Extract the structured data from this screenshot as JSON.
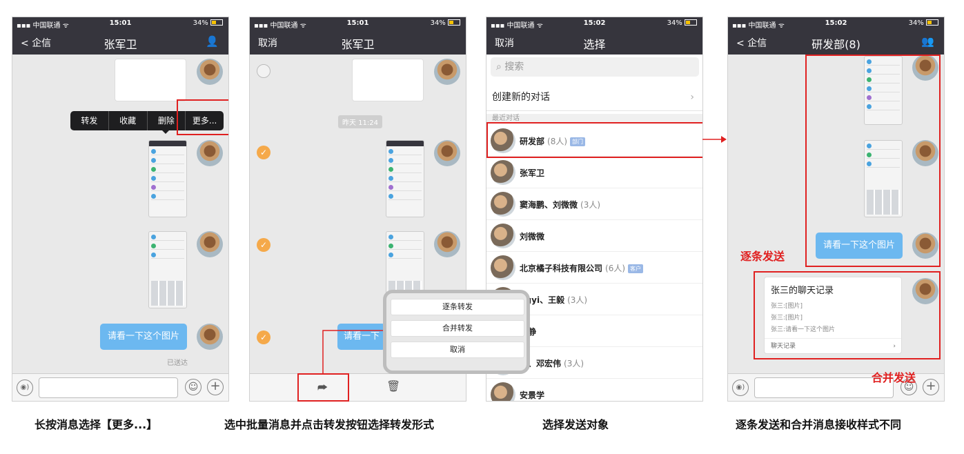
{
  "status": {
    "carrier": "中国联通",
    "battery": "34%"
  },
  "screen1": {
    "time": "15:01",
    "back": "企信",
    "title": "张军卫",
    "menu": [
      "转发",
      "收藏",
      "删除",
      "更多..."
    ],
    "message": "请看一下这个图片",
    "sent": "已送达"
  },
  "screen2": {
    "time": "15:01",
    "left": "取消",
    "title": "张军卫",
    "timestamp": "昨天 11:24",
    "message": "请看一下",
    "options": [
      "逐条转发",
      "合并转发",
      "取消"
    ]
  },
  "screen3": {
    "time": "15:02",
    "left": "取消",
    "title": "选择",
    "search_placeholder": "搜索",
    "new_chat": "创建新的对话",
    "recent_label": "最近对话",
    "contacts": [
      {
        "name": "研发部",
        "count": "(8人)",
        "tag": "部门"
      },
      {
        "name": "张军卫",
        "count": "",
        "tag": ""
      },
      {
        "name": "窦海鹏、刘微微",
        "count": "(3人)",
        "tag": ""
      },
      {
        "name": "刘微微",
        "count": "",
        "tag": ""
      },
      {
        "name": "北京橘子科技有限公司",
        "count": "(6人)",
        "tag": "客户"
      },
      {
        "name": "ngyi、王毅",
        "count": "(3人)",
        "tag": ""
      },
      {
        "name": "文静",
        "count": "",
        "tag": ""
      },
      {
        "name": "林、邓宏伟",
        "count": "(3人)",
        "tag": ""
      },
      {
        "name": "安景学",
        "count": "",
        "tag": ""
      }
    ]
  },
  "screen4": {
    "time": "15:02",
    "back": "企信",
    "title": "研发部(8)",
    "message": "请看一下这个图片",
    "merged_title": "张三的聊天记录",
    "merged_lines": [
      "张三:[图片]",
      "张三:[图片]",
      "张三:请看一下这个图片"
    ],
    "merged_footer": "聊天记录",
    "label_one_by_one": "逐条发送",
    "label_merged": "合并发送"
  },
  "captions": [
    "长按消息选择【更多...】",
    "选中批量消息并点击转发按钮选择转发形式",
    "选择发送对象",
    "逐条发送和合并消息接收样式不同"
  ],
  "accent": "#e02020"
}
